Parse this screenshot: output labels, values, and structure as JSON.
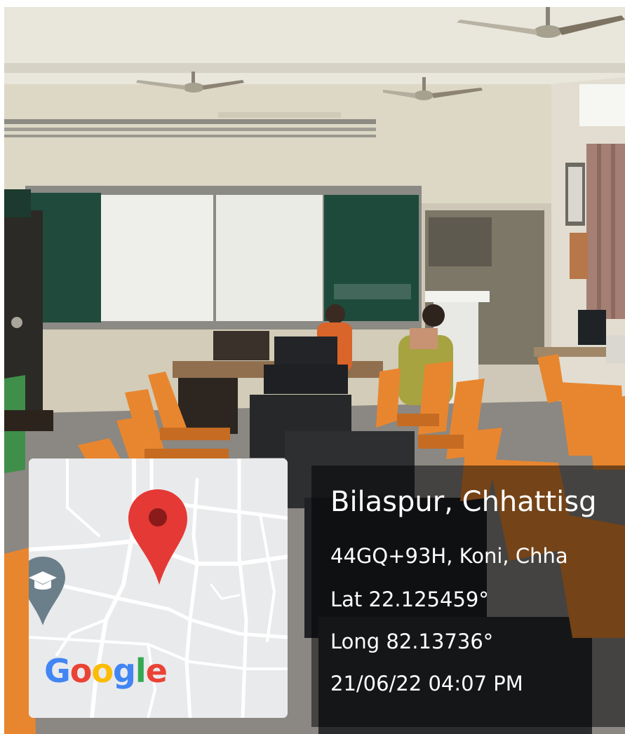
{
  "overlay": {
    "title": "Bilaspur, Chhattisg",
    "address": "44GQ+93H, Koni, Chha",
    "latitude": "Lat 22.125459°",
    "longitude": "Long 82.13736°",
    "datetime": "21/06/22 04:07 PM"
  },
  "map": {
    "logo_letters": [
      "G",
      "o",
      "o",
      "g",
      "l",
      "e"
    ],
    "logo_colors": [
      "#4285F4",
      "#EA4335",
      "#FBBC05",
      "#4285F4",
      "#34A853",
      "#EA4335"
    ],
    "pin_color": "#E53935",
    "pin_dot_color": "#8B1A1A",
    "poi_icon": "graduation-cap-icon",
    "poi_color": "#6b7f8a",
    "location_pin_icon": "location-pin-icon"
  },
  "scene": {
    "description_tags": [
      "classroom",
      "computer-lab",
      "whiteboards",
      "ceiling-fans",
      "orange-chairs",
      "computer-monitors"
    ]
  }
}
